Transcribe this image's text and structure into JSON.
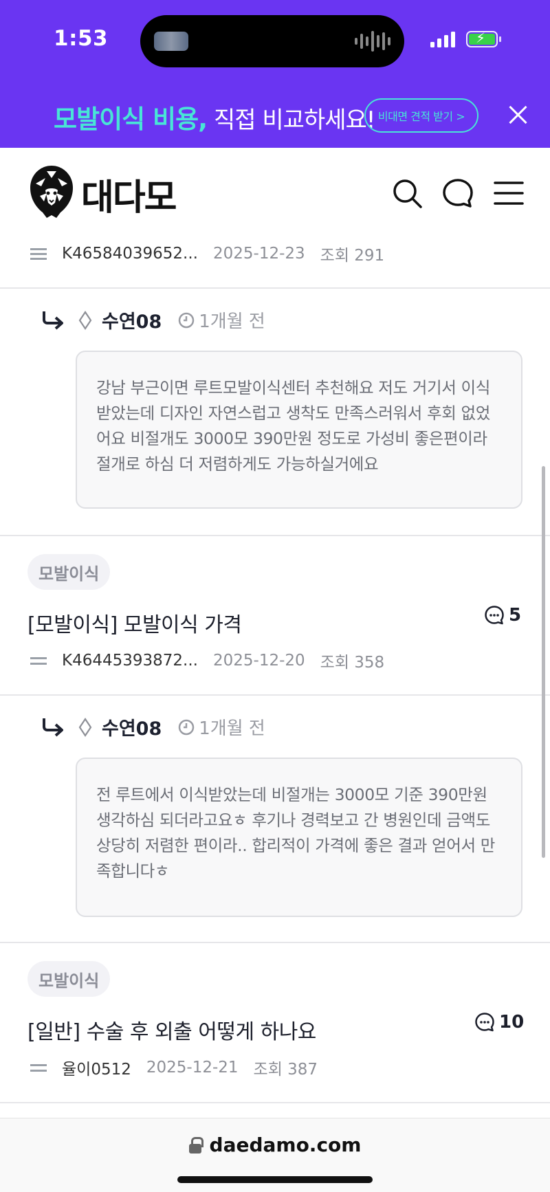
{
  "status_bar": {
    "time": "1:53"
  },
  "banner": {
    "highlight": "모발이식 비용,",
    "text": " 직접 비교하세요!",
    "cta_label": "비대면 견적 받기 >"
  },
  "site": {
    "logo_text": "대다모",
    "url": "daedamo.com"
  },
  "top_meta": {
    "author": "K46584039652...",
    "date": "2025-12-23",
    "views": "조회 291"
  },
  "replies": [
    {
      "user": "수연08",
      "time": "1개월 전",
      "body": "강남 부근이면 루트모발이식센터 추천해요 저도 거기서 이식받았는데 디자인 자연스럽고 생착도 만족스러워서 후회 없었어요 비절개도 3000모 390만원 정도로 가성비 좋은편이라 절개로 하심 더 저렴하게도 가능하실거에요"
    },
    {
      "user": "수연08",
      "time": "1개월 전",
      "body": "전 루트에서 이식받았는데 비절개는 3000모 기준 390만원 생각하심 되더라고요ㅎ 후기나 경력보고 간 병원인데 금액도 상당히 저렴한 편이라.. 합리적이 가격에 좋은 결과 얻어서 만족합니다ㅎ"
    }
  ],
  "posts": [
    {
      "category": "모발이식",
      "title": "[모발이식] 모발이식 가격",
      "comments": "5",
      "author": "K46445393872...",
      "date": "2025-12-20",
      "views": "조회 358"
    },
    {
      "category": "모발이식",
      "title": "[일반] 수술 후 외출 어떻게 하나요",
      "comments": "10",
      "author": "율이0512",
      "date": "2025-12-21",
      "views": "조회 387"
    }
  ]
}
